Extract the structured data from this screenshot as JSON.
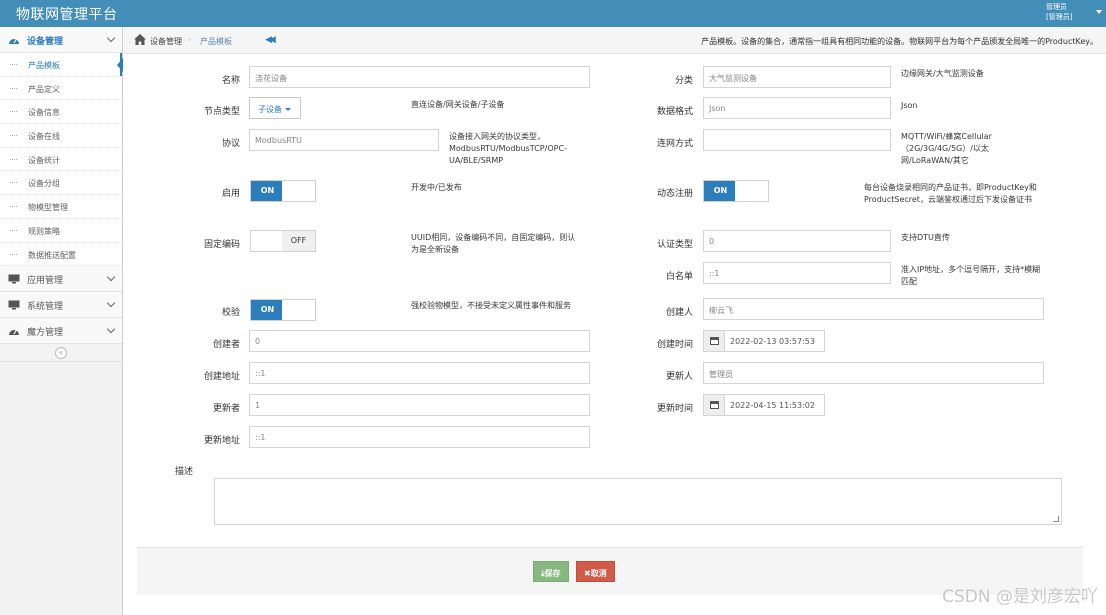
{
  "header": {
    "brand": "物联网管理平台",
    "user_line1": "管理员",
    "user_line2": "[管理员]"
  },
  "sidebar": {
    "groups": [
      {
        "label": "设备管理",
        "icon": "dashboard-icon"
      },
      {
        "label": "应用管理",
        "icon": "monitor-icon"
      },
      {
        "label": "系统管理",
        "icon": "monitor-icon"
      },
      {
        "label": "魔方管理",
        "icon": "dashboard-icon"
      }
    ],
    "sub_items": [
      "产品模板",
      "产品定义",
      "设备信息",
      "设备在线",
      "设备统计",
      "设备分组",
      "物模型管理",
      "规则策略",
      "数据推送配置"
    ],
    "collapse_glyph": "«"
  },
  "breadcrumb": {
    "home": "设备管理",
    "sep": "›",
    "current": "产品模板",
    "back_glyph": "◀◀",
    "description": "产品模板。设备的集合，通常指一组具有相同功能的设备。物联网平台为每个产品颁发全局唯一的ProductKey。"
  },
  "form": {
    "name": {
      "label": "名称",
      "value": "浇花设备"
    },
    "category": {
      "label": "分类",
      "value": "大气监测设备",
      "help": "边缘网关/大气监测设备"
    },
    "node_type": {
      "label": "节点类型",
      "value": "子设备",
      "help": "直连设备/网关设备/子设备"
    },
    "data_format": {
      "label": "数据格式",
      "value": "Json",
      "help": "Json"
    },
    "protocol": {
      "label": "协议",
      "value": "ModbusRTU",
      "help": "设备接入网关的协议类型，ModbusRTU/ModbusTCP/OPC-UA/BLE/SRMP"
    },
    "network": {
      "label": "连网方式",
      "value": "",
      "help": "MQTT/WiFi/蜂窝Cellular（2G/3G/4G/5G）/以太网/LoRaWAN/其它"
    },
    "enable": {
      "label": "启用",
      "on": "ON",
      "help": "开发中/已发布"
    },
    "dynamic_register": {
      "label": "动态注册",
      "on": "ON",
      "help": "每台设备烧录相同的产品证书，即ProductKey和ProductSecret，云端鉴权通过后下发设备证书"
    },
    "fixed_code": {
      "label": "固定编码",
      "off": "OFF",
      "help": "UUID相同，设备编码不同，自固定编码，则认为是全新设备"
    },
    "auth_type": {
      "label": "认证类型",
      "value": "0",
      "help": "支持DTU直传"
    },
    "whitelist": {
      "label": "白名单",
      "value": "::1",
      "help": "准入IP地址，多个逗号隔开，支持*模糊匹配"
    },
    "verify": {
      "label": "校验",
      "on": "ON",
      "help": "强校验物模型，不接受未定义属性事件和服务"
    },
    "creator": {
      "label": "创建人",
      "value": "柳云飞"
    },
    "creator_id": {
      "label": "创建者",
      "value": "0"
    },
    "create_time": {
      "label": "创建时间",
      "value": "2022-02-13 03:57:53"
    },
    "create_addr": {
      "label": "创建地址",
      "value": "::1"
    },
    "updater": {
      "label": "更新人",
      "value": "管理员"
    },
    "updater_id": {
      "label": "更新者",
      "value": "1"
    },
    "update_time": {
      "label": "更新时间",
      "value": "2022-04-15 11:53:02"
    },
    "update_addr": {
      "label": "更新地址",
      "value": "::1"
    },
    "description": {
      "label": "描述",
      "value": ""
    }
  },
  "actions": {
    "save": "保存",
    "cancel": "取消",
    "save_icon": "download-icon",
    "cancel_icon": "close-icon"
  },
  "watermark": "CSDN @是刘彦宏吖",
  "colors": {
    "topbar": "#438eb9",
    "accent": "#2b7dbc",
    "save": "#87b87f",
    "cancel": "#d15b47"
  }
}
